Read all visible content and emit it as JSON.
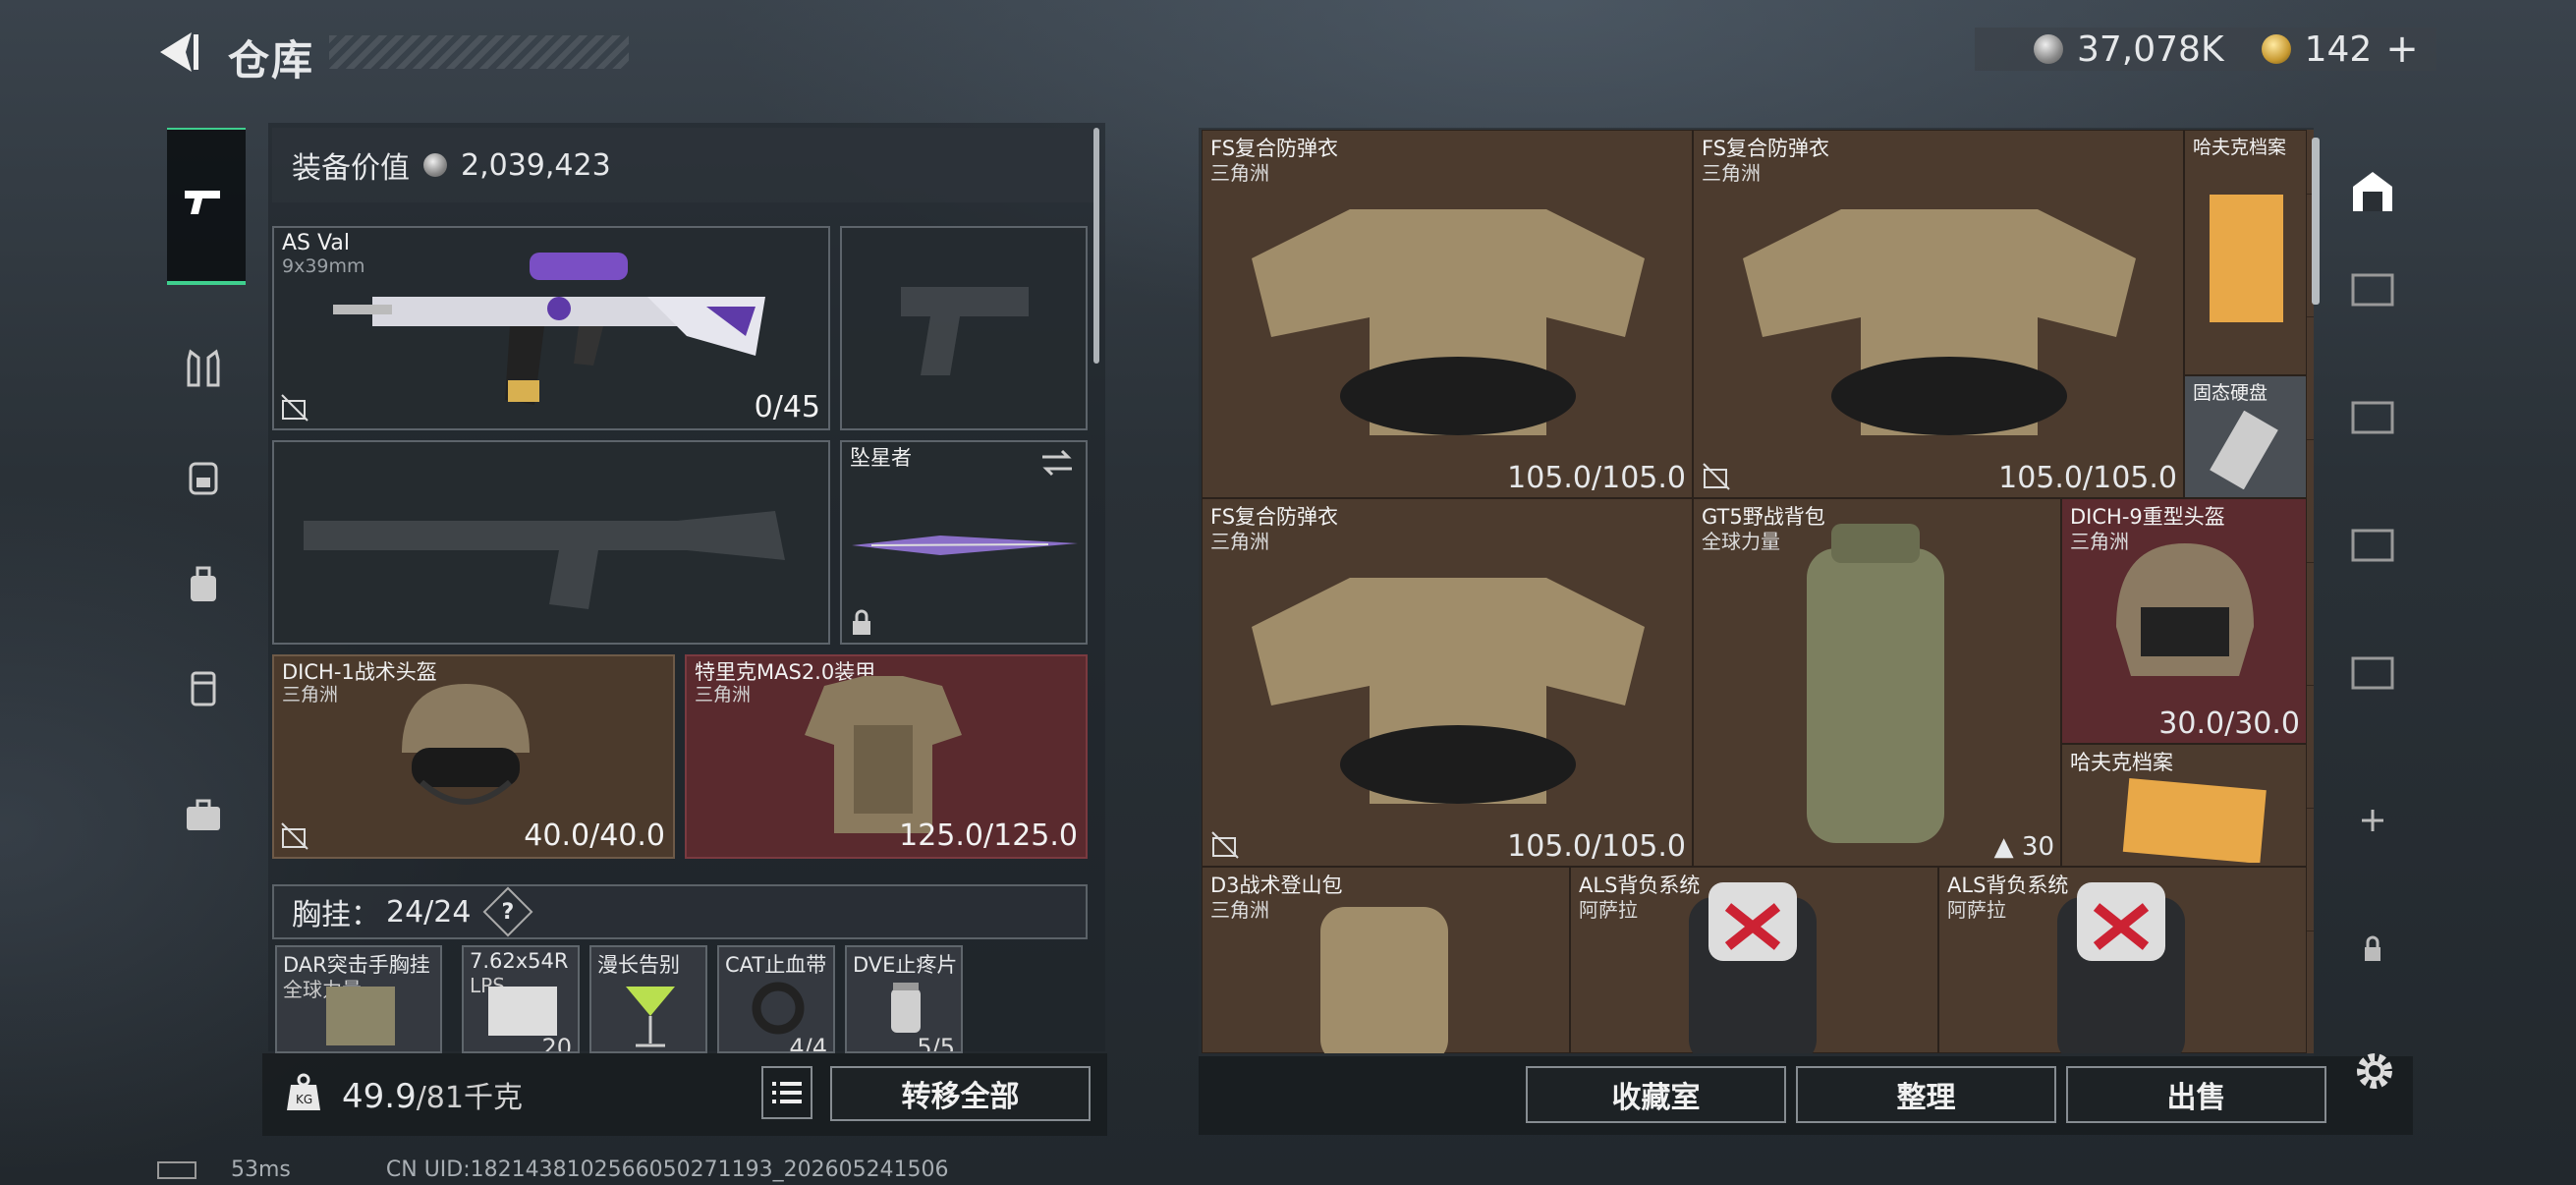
{
  "header": {
    "title": "仓库",
    "silver": "37,078K",
    "gold": "142",
    "gold_plus": "+"
  },
  "equipment": {
    "value_label": "装备价值",
    "value": "2,039,423",
    "weapon": {
      "name": "AS Val",
      "caliber": "9x39mm",
      "ammo": "0/45"
    },
    "melee": {
      "name": "坠星者"
    },
    "helmet": {
      "name": "DICH-1战术头盔",
      "brand": "三角洲",
      "durability": "40.0/40.0"
    },
    "armor": {
      "name": "特里克MAS2.0装甲",
      "brand": "三角洲",
      "durability": "125.0/125.0"
    },
    "chest": {
      "label": "胸挂：",
      "count": "24/24",
      "help": "?"
    },
    "chest_items": [
      {
        "name": "DAR突击手胸挂",
        "sub": "全球力量",
        "count": ""
      },
      {
        "name": "7.62x54R",
        "sub": "LPS",
        "count": "20"
      },
      {
        "name": "漫长告别",
        "sub": "",
        "count": ""
      },
      {
        "name": "CAT止血带",
        "sub": "",
        "count": "4/4"
      },
      {
        "name": "DVE止疼片",
        "sub": "",
        "count": "5/5"
      }
    ],
    "weight": "49.9",
    "weight_max": "/81千克",
    "transfer_all": "转移全部"
  },
  "stash": {
    "items": [
      {
        "name": "FS复合防弹衣",
        "brand": "三角洲",
        "durability": "105.0/105.0"
      },
      {
        "name": "FS复合防弹衣",
        "brand": "三角洲",
        "durability": "105.0/105.0"
      },
      {
        "name": "哈夫克档案",
        "brand": ""
      },
      {
        "name": "固态硬盘",
        "brand": ""
      },
      {
        "name": "FS复合防弹衣",
        "brand": "三角洲",
        "durability": "105.0/105.0"
      },
      {
        "name": "GT5野战背包",
        "brand": "全球力量",
        "capacity": "30"
      },
      {
        "name": "DICH-9重型头盔",
        "brand": "三角洲",
        "durability": "30.0/30.0"
      },
      {
        "name": "哈夫克档案",
        "brand": ""
      },
      {
        "name": "D3战术登山包",
        "brand": "三角洲"
      },
      {
        "name": "ALS背负系统",
        "brand": "阿萨拉"
      },
      {
        "name": "ALS背负系统",
        "brand": "阿萨拉"
      }
    ],
    "buttons": {
      "collection": "收藏室",
      "sort": "整理",
      "sell": "出售"
    }
  },
  "footer": {
    "ping": "53ms",
    "uid": "CN UID:1821438102566050271193_202605241506"
  },
  "colors": {
    "accent": "#3fcf8e",
    "red_slot": "#5a2a2e",
    "brown_slot": "#4b3a2c"
  }
}
